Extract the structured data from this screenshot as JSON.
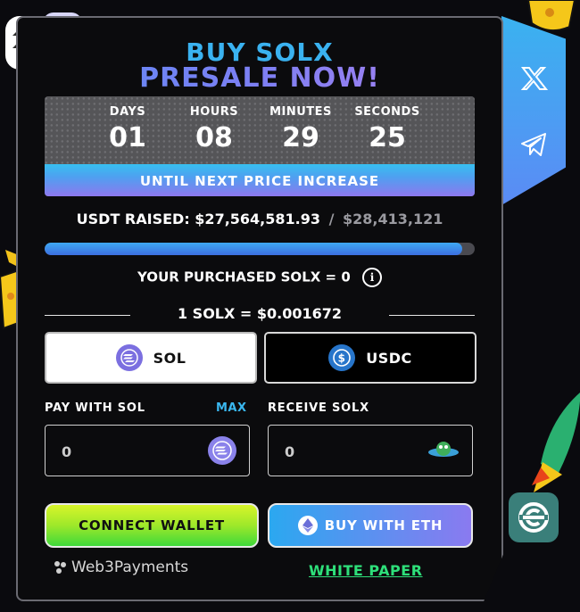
{
  "header": {
    "title_line1": "BUY SOLX",
    "title_line2": "PRESALE NOW!"
  },
  "countdown": {
    "units": [
      {
        "label": "DAYS",
        "value": "01"
      },
      {
        "label": "HOURS",
        "value": "08"
      },
      {
        "label": "MINUTES",
        "value": "29"
      },
      {
        "label": "SECONDS",
        "value": "25"
      }
    ],
    "banner": "UNTIL NEXT PRICE INCREASE"
  },
  "raised": {
    "label": "USDT RAISED:",
    "amount": "$27,564,581.93",
    "separator": "/",
    "goal": "$28,413,121",
    "progress_fraction": 0.97
  },
  "purchase": {
    "text": "YOUR PURCHASED SOLX = 0",
    "info_glyph": "i"
  },
  "rate": {
    "text": "1 SOLX = $0.001672"
  },
  "tokens": {
    "sol_label": "SOL",
    "usdc_label": "USDC",
    "selected": "SOL"
  },
  "form": {
    "pay_label": "PAY WITH SOL",
    "max_label": "MAX",
    "receive_label": "RECEIVE SOLX",
    "pay_value": "0",
    "receive_value": "0"
  },
  "actions": {
    "connect_label": "CONNECT WALLET",
    "buy_eth_label": "BUY WITH ETH"
  },
  "footer": {
    "brand": "Web3Payments",
    "white_paper": "WHITE PAPER"
  },
  "social": {
    "x_icon": "x-logo-icon",
    "telegram_icon": "telegram-icon"
  },
  "colors": {
    "accent_blue": "#3ab2f0",
    "accent_purple": "#8a7af0",
    "green": "#2ee07a",
    "lime": "#c4f02a"
  }
}
